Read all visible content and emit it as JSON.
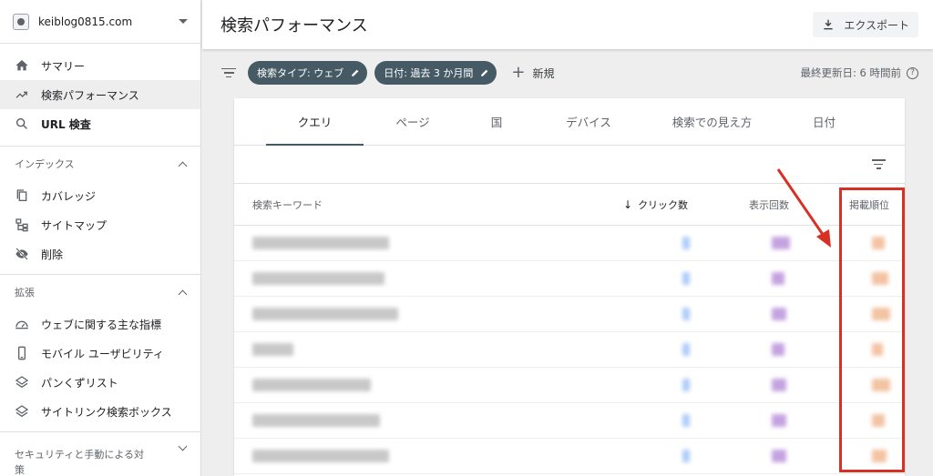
{
  "sidebar": {
    "property": "keiblog0815.com",
    "nav": [
      {
        "label": "サマリー",
        "icon": "home-icon"
      },
      {
        "label": "検索パフォーマンス",
        "icon": "trending-up-icon"
      },
      {
        "label": "URL 検査",
        "icon": "search-icon"
      }
    ],
    "index_section": {
      "title": "インデックス",
      "items": [
        {
          "label": "カバレッジ",
          "icon": "file-copy-icon"
        },
        {
          "label": "サイトマップ",
          "icon": "sitemap-icon"
        },
        {
          "label": "削除",
          "icon": "eye-off-icon"
        }
      ]
    },
    "enhancements_section": {
      "title": "拡張",
      "items": [
        {
          "label": "ウェブに関する主な指標",
          "icon": "speedometer-icon"
        },
        {
          "label": "モバイル ユーザビリティ",
          "icon": "smartphone-icon"
        },
        {
          "label": "パンくずリスト",
          "icon": "layers-icon"
        },
        {
          "label": "サイトリンク検索ボックス",
          "icon": "layers-icon"
        }
      ]
    },
    "security_section": {
      "title": "セキュリティと手動による対策"
    }
  },
  "header": {
    "title": "検索パフォーマンス",
    "export_label": "エクスポート"
  },
  "filters": {
    "chips": [
      "検索タイプ: ウェブ",
      "日付: 過去 3 か月間"
    ],
    "new_label": "新規",
    "last_updated": "最終更新日: 6 時間前"
  },
  "tabs": [
    "クエリ",
    "ページ",
    "国",
    "デバイス",
    "検索での見え方",
    "日付"
  ],
  "table": {
    "headers": {
      "keyword": "検索キーワード",
      "clicks": "クリック数",
      "impressions": "表示回数",
      "position": "掲載順位"
    },
    "row_count": 7
  },
  "colors": {
    "chip_bg": "#455a64",
    "highlight": "#d93025",
    "clicks_blur": "#aecbfa",
    "impressions_blur": "#c5a3e0",
    "position_blur": "#f3c3a3"
  }
}
